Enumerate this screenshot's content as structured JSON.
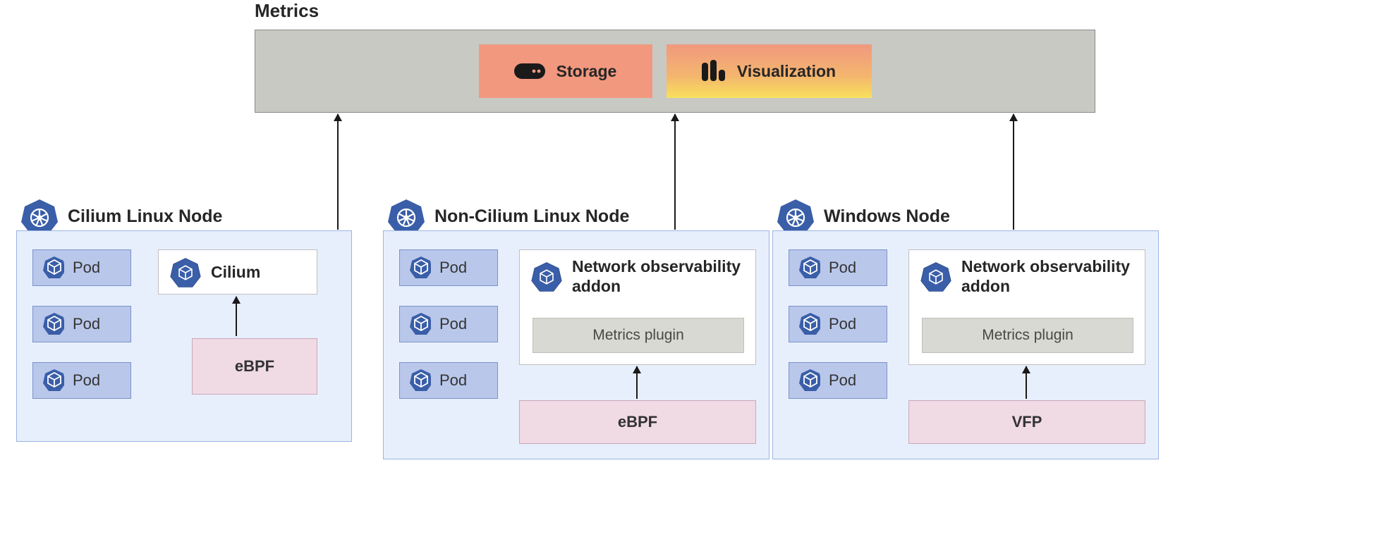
{
  "metrics": {
    "title": "Metrics",
    "storage_label": "Storage",
    "visualization_label": "Visualization"
  },
  "nodes": {
    "cilium": {
      "title": "Cilium Linux Node",
      "pods": [
        "Pod",
        "Pod",
        "Pod"
      ],
      "addon_label": "Cilium",
      "driver_label": "eBPF"
    },
    "noncilium": {
      "title": "Non-Cilium Linux Node",
      "pods": [
        "Pod",
        "Pod",
        "Pod"
      ],
      "addon_label": "Network observability addon",
      "plugin_label": "Metrics plugin",
      "driver_label": "eBPF"
    },
    "windows": {
      "title": "Windows Node",
      "pods": [
        "Pod",
        "Pod",
        "Pod"
      ],
      "addon_label": "Network observability addon",
      "plugin_label": "Metrics plugin",
      "driver_label": "VFP"
    }
  },
  "icons": {
    "k8s": "k8s-wheel-icon",
    "cube": "cube-icon",
    "storage": "server-icon",
    "viz": "bars-icon"
  }
}
